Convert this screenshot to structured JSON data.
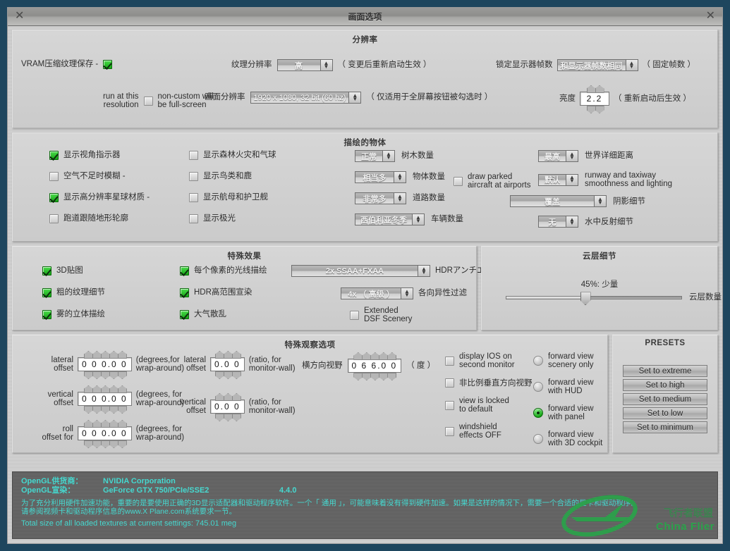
{
  "window": {
    "title": "画面选项",
    "close_icon": "close-x-icon"
  },
  "resolution": {
    "title": "分辨率",
    "vram_label": "VRAM压缩纹理保存 -",
    "vram_checked": true,
    "texture_res_label": "纹理分辨率",
    "texture_res_value": "高",
    "texture_res_note": "（ 变更后重新启动生效 ）",
    "fps_lock_label": "锁定显示器帧数",
    "fps_lock_value": "和显示器帧数相同",
    "fps_lock_note": "（ 固定帧数 ）",
    "run_at_label_1": "run at this",
    "run_at_label_2": "resolution",
    "noncustom_label_1": "non-custom will",
    "noncustom_label_2": "be full-screen",
    "fullscreen_checked": false,
    "screen_res_label": "画面分辨率",
    "screen_res_value": "1920 x 1080, 32 bit (60 hz)",
    "screen_res_note": "（ 仅适用于全屏幕按钮被勾选时 ）",
    "brightness_label": "亮度",
    "brightness_value": "2.2",
    "brightness_note": "（ 重新启动后生效 ）"
  },
  "objects": {
    "title": "描绘的物体",
    "col1": [
      {
        "label": "显示视角指示器",
        "checked": true
      },
      {
        "label": "空气不足时模糊 -",
        "checked": false
      },
      {
        "label": "显示高分辨率星球材质 -",
        "checked": true
      },
      {
        "label": "跑道跟随地形轮廓",
        "checked": false
      }
    ],
    "col2": [
      {
        "label": "显示森林火灾和气球",
        "checked": false
      },
      {
        "label": "显示鸟类和鹿",
        "checked": false
      },
      {
        "label": "显示航母和护卫舰",
        "checked": false
      },
      {
        "label": "显示极光",
        "checked": false
      }
    ],
    "col3": [
      {
        "value": "正常",
        "label": "树木数量",
        "wide": false
      },
      {
        "value": "相当多",
        "label": "物体数量",
        "wide": false
      },
      {
        "value": "非常多",
        "label": "道路数量",
        "wide": false
      },
      {
        "value": "西伯利亚冬季",
        "label": "车辆数量",
        "wide": false
      }
    ],
    "parked_aircraft_label_1": "draw parked",
    "parked_aircraft_label_2": "aircraft at airports",
    "parked_aircraft_checked": false,
    "col4": [
      {
        "value": "最高",
        "label": "世界详细距离",
        "label2": "",
        "wide": false
      },
      {
        "value": "默认",
        "label": "runway and taxiway",
        "label2": "smoothness and lighting",
        "wide": false
      },
      {
        "value": "覆盖",
        "label": "阴影细节",
        "label2": "",
        "wide": true
      },
      {
        "value": "无",
        "label": "水中反射细节",
        "label2": "",
        "wide": false
      }
    ]
  },
  "effects": {
    "title": "特殊效果",
    "col1": [
      {
        "label": "3D贴图",
        "checked": true
      },
      {
        "label": "粗的纹理细节",
        "checked": true
      },
      {
        "label": "雾的立体描绘",
        "checked": true
      }
    ],
    "col2": [
      {
        "label": "每个像素的光线描绘",
        "checked": true
      },
      {
        "label": "HDR高范围宣染",
        "checked": true
      },
      {
        "label": "大气散乱",
        "checked": true
      }
    ],
    "aa_value": "2x SSAA+FXAA",
    "aa_label": "HDRアンチエイリアス",
    "aniso_value": "4x     （ 高级 ）",
    "aniso_label": "各向异性过滤",
    "extended_dsf_label_1": "Extended",
    "extended_dsf_label_2": "DSF Scenery",
    "extended_dsf_checked": false
  },
  "clouds": {
    "title": "云层细节",
    "slider_text": "45%: 少量",
    "slider_percent": 45,
    "slider_label": "云层数量"
  },
  "viewing": {
    "title": "特殊观察选项",
    "spinners_left": [
      {
        "label1": "lateral",
        "label2": "offset",
        "value": "0 0 0.0 0",
        "digits": 5,
        "note1": "(degrees,for",
        "note2": "wrap-around)"
      },
      {
        "label1": "vertical",
        "label2": "offset",
        "value": "0 0 0.0 0",
        "digits": 5,
        "note1": "(degrees, for",
        "note2": "wrap-around)"
      },
      {
        "label1": "roll",
        "label2": "offset for",
        "value": "0 0 0.0 0",
        "digits": 5,
        "note1": "(degrees, for",
        "note2": "wrap-around)"
      }
    ],
    "spinners_mid": [
      {
        "label1": "lateral",
        "label2": "offset",
        "value": "0.0 0",
        "digits": 3,
        "note1": "(ratio, for",
        "note2": "monitor-wall)"
      },
      {
        "label1": "vertical",
        "label2": "offset",
        "value": "0.0 0",
        "digits": 3,
        "note1": "(ratio, for",
        "note2": "monitor-wall)"
      }
    ],
    "fov_label": "横方向视野",
    "fov_value": "0 6 6.0 0",
    "fov_digits": 5,
    "fov_note": "（ 度 ）",
    "checkboxes": [
      {
        "label1": "display IOS on",
        "label2": "second monitor",
        "checked": false
      },
      {
        "label1": "非比例垂直方向视野",
        "label2": "",
        "checked": false
      },
      {
        "label1": "view is locked",
        "label2": "to default",
        "checked": false
      },
      {
        "label1": "windshield",
        "label2": "effects OFF",
        "checked": false
      }
    ],
    "radios": [
      {
        "label1": "forward view",
        "label2": "scenery only",
        "selected": false
      },
      {
        "label1": "forward view",
        "label2": "with HUD",
        "selected": false
      },
      {
        "label1": "forward view",
        "label2": "with panel",
        "selected": true
      },
      {
        "label1": "forward view",
        "label2": "with 3D cockpit",
        "selected": false
      }
    ]
  },
  "presets": {
    "title": "PRESETS",
    "buttons": [
      "Set to extreme",
      "Set to high",
      "Set to medium",
      "Set to low",
      "Set to minimum"
    ]
  },
  "info": {
    "vendor_label": "OpenGL供货商：",
    "vendor_value": "NVIDIA Corporation",
    "renderer_label": "OpenGL宣染：",
    "renderer_value": "GeForce GTX 750/PCIe/SSE2",
    "version_value": "4.4.0",
    "note_line1": "为了充分利用硬件加速功能，重要的是要使用正确的3D显示适配器和驱动程序软件。一个「 通用 」，可能意味着没有得到硬件加速。如果是这样的情况下，需要一个合适的显卡和驱动程序。",
    "note_line2": "请参阅视频卡和驱动程序信息的www.X Plane.com系统要求一节。",
    "texture_line": "Total size of all loaded textures at current settings: 745.01 meg",
    "watermark_en": "China Flier",
    "watermark_cn": "飞行者联盟"
  },
  "colors": {
    "desktop": "#1e465e",
    "panel": "#d2d2d2",
    "info_text": "#45d8cf",
    "checked": "#16a616",
    "watermark": "#2aa34a"
  }
}
